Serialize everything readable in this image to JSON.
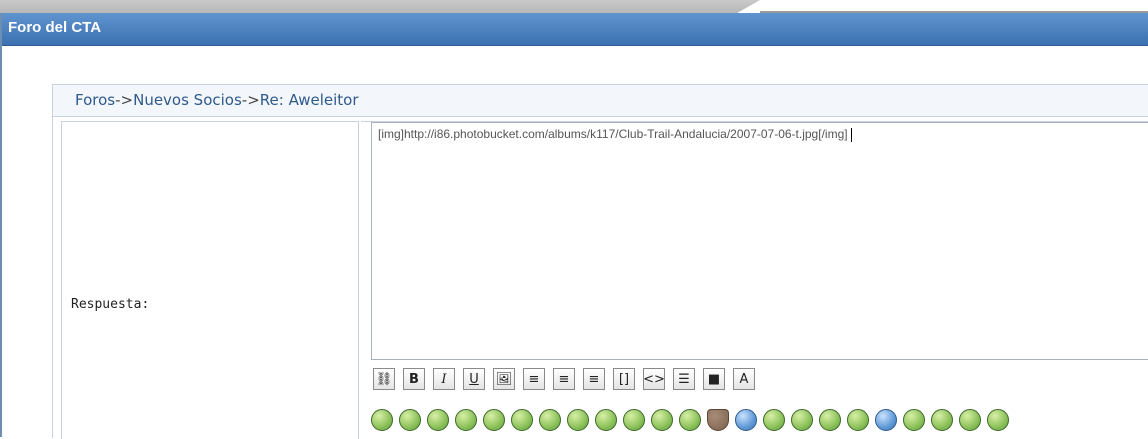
{
  "window": {
    "title": "Foro del CTA"
  },
  "breadcrumb": {
    "items": [
      "Foros",
      "Nuevos Socios",
      "Re: Aweleitor"
    ],
    "separator": "->"
  },
  "form": {
    "reply_label": "Respuesta:",
    "reply_value": "[img]http://i86.photobucket.com/albums/k117/Club-Trail-Andalucia/2007-07-06-t.jpg[/img]"
  },
  "toolbar": {
    "buttons": [
      {
        "name": "link-button",
        "glyph": "⛓"
      },
      {
        "name": "bold-button",
        "glyph": "B"
      },
      {
        "name": "italic-button",
        "glyph": "I"
      },
      {
        "name": "underline-button",
        "glyph": "U"
      },
      {
        "name": "image-button",
        "glyph": "🖼"
      },
      {
        "name": "align-center-button",
        "glyph": "≡"
      },
      {
        "name": "align-left-button",
        "glyph": "≡"
      },
      {
        "name": "align-right-button",
        "glyph": "≡"
      },
      {
        "name": "brackets-button",
        "glyph": "[]"
      },
      {
        "name": "code-button",
        "glyph": "<>"
      },
      {
        "name": "list-button",
        "glyph": "☰"
      },
      {
        "name": "color-button",
        "glyph": "■"
      },
      {
        "name": "font-button",
        "glyph": "A"
      }
    ]
  },
  "smileys": [
    "alien-smiley-icon",
    "crazy-smiley-icon",
    "dead-smiley-icon",
    "grin-smiley-icon",
    "laugh-smiley-icon",
    "smile-smiley-icon",
    "scared-smiley-icon",
    "sick-smiley-icon",
    "cool-smiley-icon",
    "sad-smiley-icon",
    "angry-smiley-icon",
    "happy-smiley-icon",
    "heart-icon",
    "idea-smiley-icon",
    "shocked-smiley-icon",
    "mad-smiley-icon",
    "wink-smiley-icon",
    "neutral-smiley-icon",
    "question-smiley-icon",
    "silly-smiley-icon",
    "cry-smiley-icon",
    "nerd-smiley-icon",
    "tongue-smiley-icon"
  ],
  "colors": {
    "titlebar": "#4a80c0",
    "link": "#2f5a8c",
    "border": "#c9d3de"
  }
}
